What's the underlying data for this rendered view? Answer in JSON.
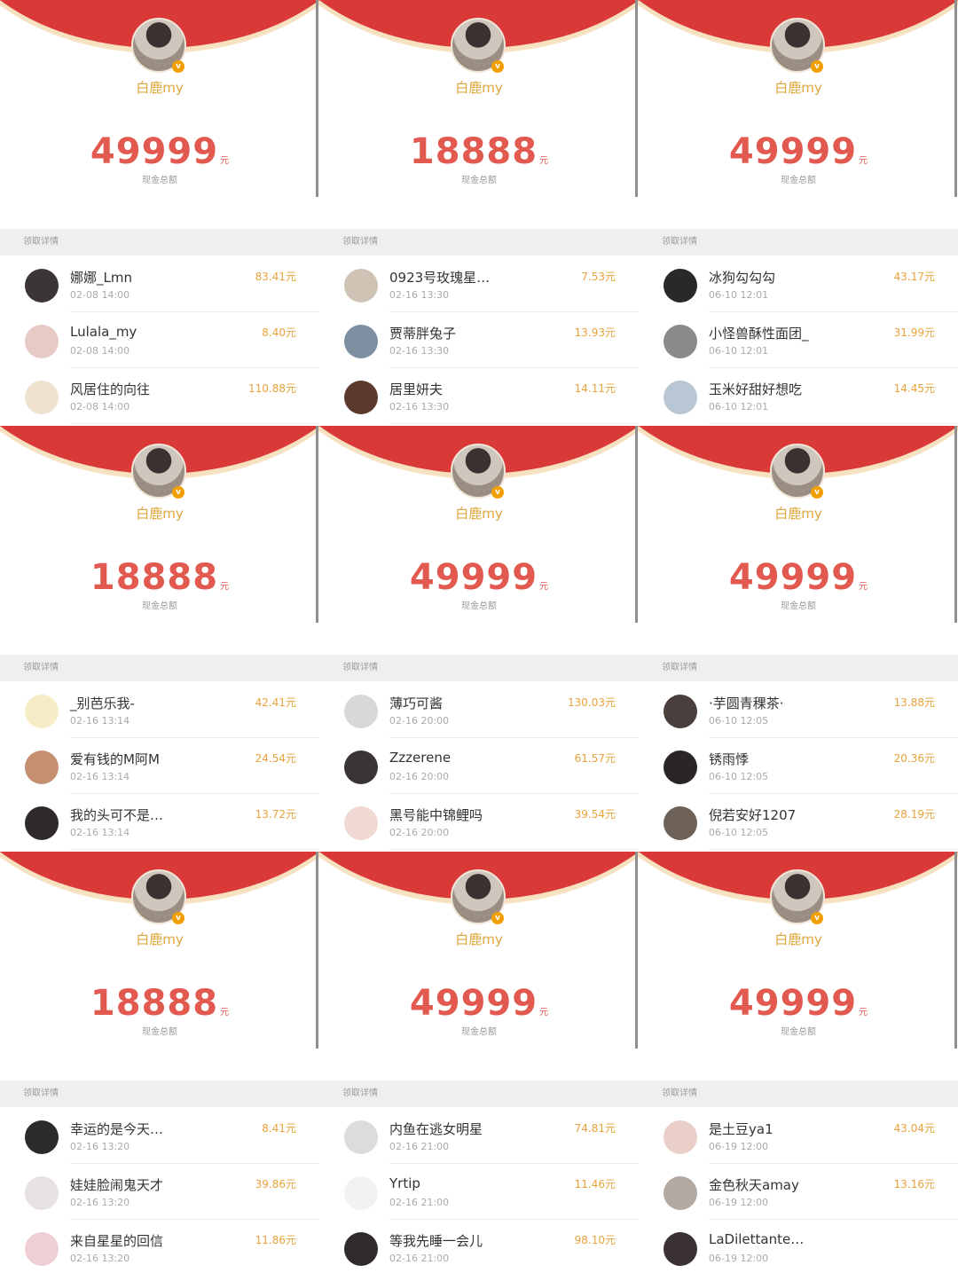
{
  "colors": {
    "red": "#d93a38",
    "cream": "#f6e1c0",
    "amount": "#e25950",
    "gold": "#e8a23a"
  },
  "cells": [
    {
      "sender": "白鹿my",
      "amount": "49999",
      "unit": "元",
      "subtitle": "现金总额",
      "section": "领取详情",
      "rows": [
        {
          "name": "娜娜_Lmn",
          "time": "02-08 14:00",
          "amount": "83.41元",
          "avatar": "#3b3635"
        },
        {
          "name": "Lulala_my",
          "time": "02-08 14:00",
          "amount": "8.40元",
          "avatar": "#e7c9c5"
        },
        {
          "name": "风居住的向往",
          "time": "02-08 14:00",
          "amount": "110.88元",
          "avatar": "#efe3d0"
        }
      ]
    },
    {
      "sender": "白鹿my",
      "amount": "18888",
      "unit": "元",
      "subtitle": "现金总额",
      "section": "领取详情",
      "rows": [
        {
          "name": "0923号玫瑰星…",
          "time": "02-16 13:30",
          "amount": "7.53元",
          "avatar": "#cfc3b6"
        },
        {
          "name": "贾蒂胖兔子",
          "time": "02-16 13:30",
          "amount": "13.93元",
          "avatar": "#7d8fa0"
        },
        {
          "name": "居里妍夫",
          "time": "02-16 13:30",
          "amount": "14.11元",
          "avatar": "#5c3a2b"
        }
      ]
    },
    {
      "sender": "白鹿my",
      "amount": "49999",
      "unit": "元",
      "subtitle": "现金总额",
      "section": "领取详情",
      "rows": [
        {
          "name": "冰狗勾勾勾",
          "time": "06-10 12:01",
          "amount": "43.17元",
          "avatar": "#2b2828"
        },
        {
          "name": "小怪兽酥性面团_",
          "time": "06-10 12:01",
          "amount": "31.99元",
          "avatar": "#8c8a88"
        },
        {
          "name": "玉米好甜好想吃",
          "time": "06-10 12:01",
          "amount": "14.45元",
          "avatar": "#b9c6d4"
        }
      ]
    },
    {
      "sender": "白鹿my",
      "amount": "18888",
      "unit": "元",
      "subtitle": "现金总额",
      "section": "领取详情",
      "rows": [
        {
          "name": "_别芭乐我-",
          "time": "02-16 13:14",
          "amount": "42.41元",
          "avatar": "#f6ecc6"
        },
        {
          "name": "爱有钱的M阿M",
          "time": "02-16 13:14",
          "amount": "24.54元",
          "avatar": "#c59070"
        },
        {
          "name": "我的头可不是…",
          "time": "02-16 13:14",
          "amount": "13.72元",
          "avatar": "#2e2a2c"
        }
      ]
    },
    {
      "sender": "白鹿my",
      "amount": "49999",
      "unit": "元",
      "subtitle": "现金总额",
      "section": "领取详情",
      "rows": [
        {
          "name": "薄巧可酱",
          "time": "02-16 20:00",
          "amount": "130.03元",
          "avatar": "#d8d8d8"
        },
        {
          "name": "Zzzerene",
          "time": "02-16 20:00",
          "amount": "61.57元",
          "avatar": "#3a3434"
        },
        {
          "name": "黑号能中锦鲤吗",
          "time": "02-16 20:00",
          "amount": "39.54元",
          "avatar": "#f1d8d2"
        }
      ]
    },
    {
      "sender": "白鹿my",
      "amount": "49999",
      "unit": "元",
      "subtitle": "现金总额",
      "section": "领取详情",
      "rows": [
        {
          "name": "·芋圆青稞茶·",
          "time": "06-10 12:05",
          "amount": "13.88元",
          "avatar": "#4a3f3c"
        },
        {
          "name": "锈雨悸",
          "time": "06-10 12:05",
          "amount": "20.36元",
          "avatar": "#2a2626"
        },
        {
          "name": "倪若安好1207",
          "time": "06-10 12:05",
          "amount": "28.19元",
          "avatar": "#6e6158"
        }
      ]
    },
    {
      "sender": "白鹿my",
      "amount": "18888",
      "unit": "元",
      "subtitle": "现金总额",
      "section": "领取详情",
      "rows": [
        {
          "name": "幸运的是今天…",
          "time": "02-16 13:20",
          "amount": "8.41元",
          "avatar": "#2d2a2a"
        },
        {
          "name": "娃娃脸闹鬼天才",
          "time": "02-16 13:20",
          "amount": "39.86元",
          "avatar": "#e8e1e3"
        },
        {
          "name": "来自星星的回信",
          "time": "02-16 13:20",
          "amount": "11.86元",
          "avatar": "#efcfd3"
        }
      ]
    },
    {
      "sender": "白鹿my",
      "amount": "49999",
      "unit": "元",
      "subtitle": "现金总额",
      "section": "领取详情",
      "rows": [
        {
          "name": "内鱼在逃女明星",
          "time": "02-16 21:00",
          "amount": "74.81元",
          "avatar": "#dcdcdc"
        },
        {
          "name": "Yrtip",
          "time": "02-16 21:00",
          "amount": "11.46元",
          "avatar": "#f2f2f2"
        },
        {
          "name": "等我先睡一会儿",
          "time": "02-16 21:00",
          "amount": "98.10元",
          "avatar": "#2f2b2b"
        }
      ]
    },
    {
      "sender": "白鹿my",
      "amount": "49999",
      "unit": "元",
      "subtitle": "现金总额",
      "section": "领取详情",
      "rows": [
        {
          "name": "是土豆ya1",
          "time": "06-19 12:00",
          "amount": "43.04元",
          "avatar": "#e9cfc8"
        },
        {
          "name": "金色秋天amay",
          "time": "06-19 12:00",
          "amount": "13.16元",
          "avatar": "#b3a9a3"
        },
        {
          "name": "LaDilettante…",
          "time": "06-19 12:00",
          "amount": "",
          "avatar": "#3a3232"
        }
      ]
    }
  ]
}
